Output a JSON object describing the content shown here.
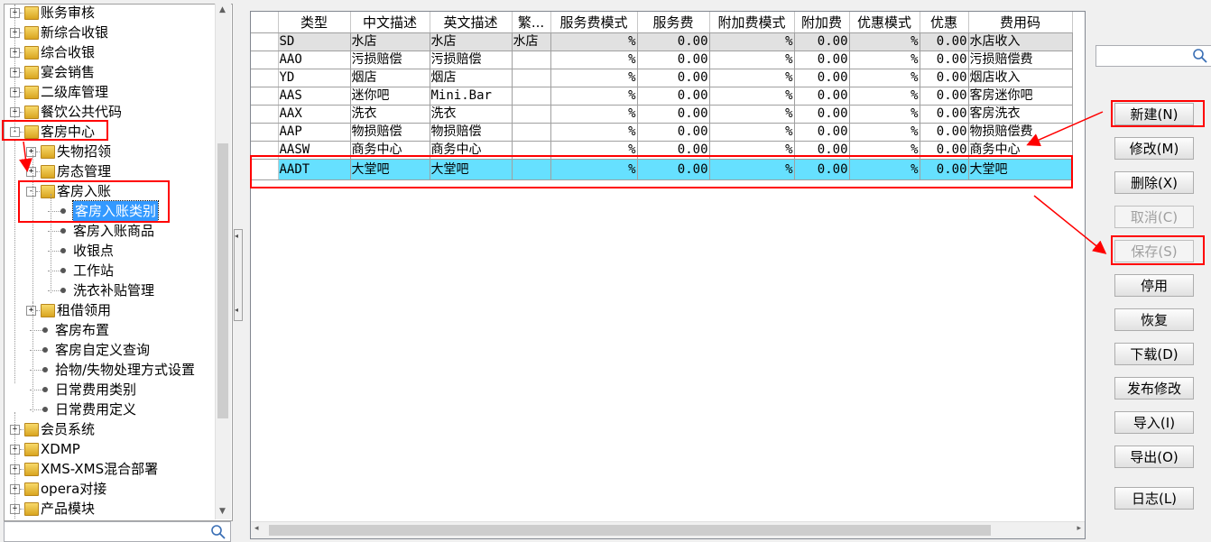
{
  "tree": {
    "items": [
      {
        "label": "账务审核",
        "level": 0,
        "type": "folder",
        "exp": "+"
      },
      {
        "label": "新综合收银",
        "level": 0,
        "type": "folder",
        "exp": "+"
      },
      {
        "label": "综合收银",
        "level": 0,
        "type": "folder",
        "exp": "+"
      },
      {
        "label": "宴会销售",
        "level": 0,
        "type": "folder",
        "exp": "+"
      },
      {
        "label": "二级库管理",
        "level": 0,
        "type": "folder",
        "exp": "+"
      },
      {
        "label": "餐饮公共代码",
        "level": 0,
        "type": "folder",
        "exp": "+"
      },
      {
        "label": "客房中心",
        "level": 0,
        "type": "folder",
        "exp": "-"
      },
      {
        "label": "失物招领",
        "level": 1,
        "type": "folder",
        "exp": "+"
      },
      {
        "label": "房态管理",
        "level": 1,
        "type": "folder",
        "exp": "+"
      },
      {
        "label": "客房入账",
        "level": 1,
        "type": "folder",
        "exp": "-"
      },
      {
        "label": "客房入账类别",
        "level": 2,
        "type": "leaf",
        "selected": true
      },
      {
        "label": "客房入账商品",
        "level": 2,
        "type": "leaf"
      },
      {
        "label": "收银点",
        "level": 2,
        "type": "leaf"
      },
      {
        "label": "工作站",
        "level": 2,
        "type": "leaf"
      },
      {
        "label": "洗衣补贴管理",
        "level": 2,
        "type": "leaf"
      },
      {
        "label": "租借领用",
        "level": 1,
        "type": "folder",
        "exp": "+"
      },
      {
        "label": "客房布置",
        "level": 1,
        "type": "leaf"
      },
      {
        "label": "客房自定义查询",
        "level": 1,
        "type": "leaf"
      },
      {
        "label": "拾物/失物处理方式设置",
        "level": 1,
        "type": "leaf"
      },
      {
        "label": "日常费用类别",
        "level": 1,
        "type": "leaf"
      },
      {
        "label": "日常费用定义",
        "level": 1,
        "type": "leaf"
      },
      {
        "label": "会员系统",
        "level": 0,
        "type": "folder",
        "exp": "+"
      },
      {
        "label": "XDMP",
        "level": 0,
        "type": "folder",
        "exp": "+"
      },
      {
        "label": "XMS-XMS混合部署",
        "level": 0,
        "type": "folder",
        "exp": "+"
      },
      {
        "label": "opera对接",
        "level": 0,
        "type": "folder",
        "exp": "+"
      },
      {
        "label": "产品模块",
        "level": 0,
        "type": "folder",
        "exp": "+"
      }
    ]
  },
  "grid": {
    "columns": [
      "类型",
      "中文描述",
      "英文描述",
      "繁...",
      "服务费模式",
      "服务费",
      "附加费模式",
      "附加费",
      "优惠模式",
      "优惠",
      "费用码"
    ],
    "rows": [
      [
        "SD",
        "水店",
        "水店",
        "水店",
        "%",
        "0.00",
        "%",
        "0.00",
        "%",
        "0.00",
        "水店收入"
      ],
      [
        "AAO",
        "污损赔偿",
        "污损赔偿",
        "",
        "%",
        "0.00",
        "%",
        "0.00",
        "%",
        "0.00",
        "污损赔偿费"
      ],
      [
        "YD",
        "烟店",
        "烟店",
        "",
        "%",
        "0.00",
        "%",
        "0.00",
        "%",
        "0.00",
        "烟店收入"
      ],
      [
        "AAS",
        "迷你吧",
        "Mini.Bar",
        "",
        "%",
        "0.00",
        "%",
        "0.00",
        "%",
        "0.00",
        "客房迷你吧"
      ],
      [
        "AAX",
        "洗衣",
        "洗衣",
        "",
        "%",
        "0.00",
        "%",
        "0.00",
        "%",
        "0.00",
        "客房洗衣"
      ],
      [
        "AAP",
        "物损赔偿",
        "物损赔偿",
        "",
        "%",
        "0.00",
        "%",
        "0.00",
        "%",
        "0.00",
        "物损赔偿费"
      ],
      [
        "AASW",
        "商务中心",
        "商务中心",
        "",
        "%",
        "0.00",
        "%",
        "0.00",
        "%",
        "0.00",
        "商务中心"
      ],
      [
        "AADT",
        "大堂吧",
        "大堂吧",
        "",
        "%",
        "0.00",
        "%",
        "0.00",
        "%",
        "0.00",
        "大堂吧"
      ]
    ],
    "selected_row": 7
  },
  "buttons": {
    "new": "新建(N)",
    "edit": "修改(M)",
    "delete": "删除(X)",
    "cancel": "取消(C)",
    "save": "保存(S)",
    "disable": "停用",
    "restore": "恢复",
    "download": "下载(D)",
    "publish": "发布修改",
    "import": "导入(I)",
    "export": "导出(O)",
    "log": "日志(L)"
  },
  "icons": {
    "search": "search-icon",
    "annotation_color": "#ff0000"
  },
  "colors": {
    "selected_row": "#66e0ff",
    "tree_selection": "#3399ff"
  }
}
